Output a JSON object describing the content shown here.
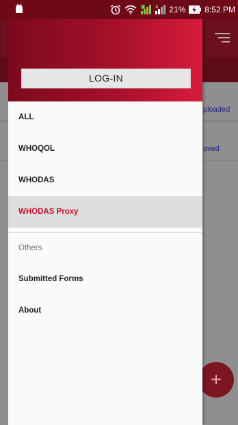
{
  "status_bar": {
    "battery_percent": "21%",
    "time": "8:52 PM",
    "icons": [
      "android-icon",
      "alarm-icon",
      "wifi-icon",
      "signal-icon-sim1",
      "signal-icon-sim2",
      "battery-charging-icon"
    ],
    "sim2_label": "2"
  },
  "drawer": {
    "login_label": "LOG-IN",
    "primary_items": [
      {
        "label": "ALL"
      },
      {
        "label": "WHOQOL"
      },
      {
        "label": "WHODAS"
      },
      {
        "label": "WHODAS Proxy",
        "selected": true
      }
    ],
    "section_header": "Others",
    "secondary_items": [
      {
        "label": "Submitted Forms"
      },
      {
        "label": "About"
      }
    ]
  },
  "background": {
    "list_rows": [
      {
        "label_fragment": "ploaded"
      },
      {
        "label_fragment": "aved"
      }
    ],
    "fab_label": "+"
  },
  "colors": {
    "accent": "#c0152e",
    "header_gradient_start": "#7c0a1c",
    "header_gradient_end": "#d81b3c",
    "selected_bg": "#dddddd"
  }
}
